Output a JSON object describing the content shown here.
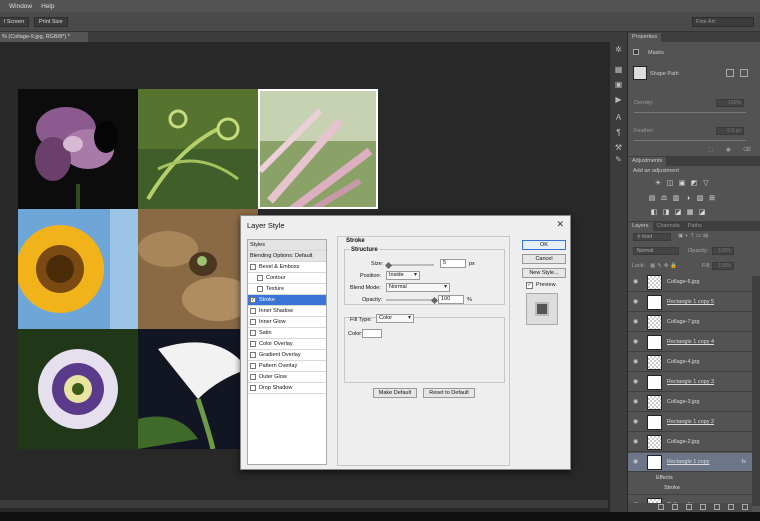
{
  "menubar": {
    "items": [
      "Window",
      "Help"
    ]
  },
  "options_bar": {
    "fit_screen_label": "l Screen",
    "print_size_label": "Print Size",
    "workspace": "Fine Art"
  },
  "document_tab": {
    "title": "% (Collage-9.jpg, RGB/8*) *"
  },
  "properties_panel": {
    "tab": "Properties",
    "masks_label": "Masks",
    "shape_path_label": "Shape Path",
    "density_label": "Density:",
    "density_value": "100%",
    "feather_label": "Feather:",
    "feather_value": "0.0 px"
  },
  "adjustments_panel": {
    "tab": "Adjustments",
    "add_label": "Add an adjustment",
    "icons_row1": [
      "☀",
      "◫",
      "▣",
      "◩",
      "▽"
    ],
    "icons_row2": [
      "▤",
      "⚖",
      "▥",
      "◑",
      "▧",
      "⊞"
    ],
    "icons_row3": [
      "◧",
      "◨",
      "◪",
      "▦",
      "◪"
    ]
  },
  "layers_panel": {
    "tabs": [
      "Layers",
      "Channels",
      "Paths"
    ],
    "kind_label": "Kind",
    "blend_mode": "Normal",
    "opacity_label": "Opacity:",
    "opacity_value": "100%",
    "lock_label": "Lock:",
    "fill_label": "Fill:",
    "fill_value": "100%",
    "layers": [
      {
        "name": "Collage-6.jpg",
        "type": "image",
        "underlined": false,
        "selected": false
      },
      {
        "name": "Rectangle 1 copy 5",
        "type": "shape",
        "underlined": true,
        "selected": false
      },
      {
        "name": "Collage-7.jpg",
        "type": "image",
        "underlined": false,
        "selected": false
      },
      {
        "name": "Rectangle 1 copy 4",
        "type": "shape",
        "underlined": true,
        "selected": false
      },
      {
        "name": "Collage-4.jpg",
        "type": "image",
        "underlined": false,
        "selected": false
      },
      {
        "name": "Rectangle 1 copy 3",
        "type": "shape",
        "underlined": true,
        "selected": false
      },
      {
        "name": "Collage-3.jpg",
        "type": "image",
        "underlined": false,
        "selected": false
      },
      {
        "name": "Rectangle 1 copy 2",
        "type": "shape",
        "underlined": true,
        "selected": false
      },
      {
        "name": "Collage-2.jpg",
        "type": "image",
        "underlined": false,
        "selected": false
      },
      {
        "name": "Rectangle 1 copy",
        "type": "shape",
        "underlined": true,
        "selected": true,
        "fx": "fx"
      }
    ],
    "effects_label": "Effects",
    "effect_stroke_label": "Stroke",
    "last_layer": {
      "name": "Collage-1.jpg"
    }
  },
  "dialog": {
    "title": "Layer Style",
    "styles_header": "Styles",
    "blending_options": "Blending Options: Default",
    "styles": [
      {
        "label": "Bevel & Emboss",
        "checked": false,
        "indent": false,
        "selected": false
      },
      {
        "label": "Contour",
        "checked": false,
        "indent": true,
        "selected": false
      },
      {
        "label": "Texture",
        "checked": false,
        "indent": true,
        "selected": false
      },
      {
        "label": "Stroke",
        "checked": true,
        "indent": false,
        "selected": true
      },
      {
        "label": "Inner Shadow",
        "checked": false,
        "indent": false,
        "selected": false
      },
      {
        "label": "Inner Glow",
        "checked": false,
        "indent": false,
        "selected": false
      },
      {
        "label": "Satin",
        "checked": false,
        "indent": false,
        "selected": false
      },
      {
        "label": "Color Overlay",
        "checked": false,
        "indent": false,
        "selected": false
      },
      {
        "label": "Gradient Overlay",
        "checked": false,
        "indent": false,
        "selected": false
      },
      {
        "label": "Pattern Overlay",
        "checked": false,
        "indent": false,
        "selected": false
      },
      {
        "label": "Outer Glow",
        "checked": false,
        "indent": false,
        "selected": false
      },
      {
        "label": "Drop Shadow",
        "checked": false,
        "indent": false,
        "selected": false
      }
    ],
    "stroke": {
      "section_title": "Stroke",
      "structure_title": "Structure",
      "size_label": "Size:",
      "size_value": "5",
      "size_unit": "px",
      "position_label": "Position:",
      "position_value": "Inside",
      "blend_label": "Blend Mode:",
      "blend_value": "Normal",
      "opacity_label": "Opacity:",
      "opacity_value": "100",
      "opacity_unit": "%",
      "size_slider_level": 0.05,
      "opacity_slider_level": 1.0,
      "fill_type_label": "Fill Type:",
      "fill_type_value": "Color",
      "color_label": "Color:",
      "color_swatch": "#ffffff",
      "make_default_label": "Make Default",
      "reset_default_label": "Reset to Default"
    },
    "buttons": {
      "ok": "OK",
      "cancel": "Cancel",
      "new_style": "New Style...",
      "preview": "Preview",
      "preview_checked": true
    }
  },
  "colors": {
    "accent": "#3875d7",
    "selected_layer": "#6d7589",
    "panel_bg": "#535353"
  }
}
